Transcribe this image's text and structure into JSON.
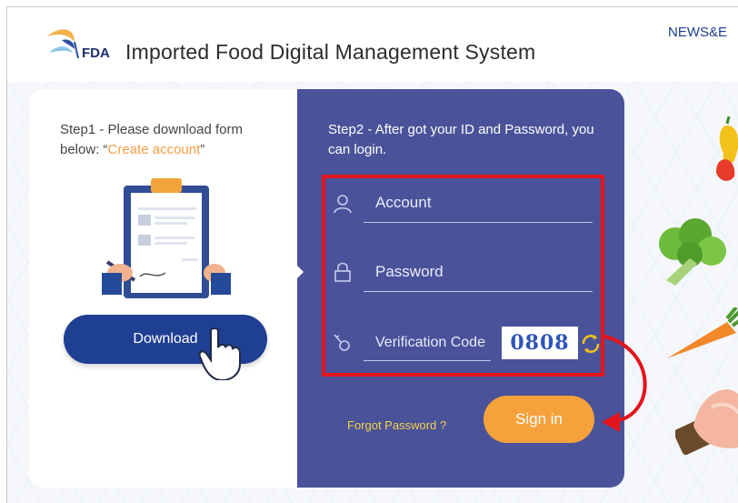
{
  "header": {
    "logo_text": "FDA",
    "title": "Imported Food Digital Management System",
    "news_link": "NEWS&E"
  },
  "left_panel": {
    "step_prefix": "Step1 - Please download form below: “",
    "create_link": "Create account",
    "step_suffix": "”",
    "download_label": "Download"
  },
  "right_panel": {
    "step_text": "Step2 - After got your ID and Password, you can login.",
    "account_placeholder": "Account",
    "password_placeholder": "Password",
    "verification_placeholder": "Verification Code",
    "captcha_value": "0808",
    "forgot_label": "Forgot Password ?",
    "signin_label": "Sign in"
  },
  "colors": {
    "panel_bg": "#4a529a",
    "download_btn": "#1f3f92",
    "signin_btn": "#f6a23c",
    "highlight": "#e3141c",
    "create_link": "#f59d43",
    "forgot_link": "#f2d34a"
  },
  "icons": [
    "fda-logo-icon",
    "user-icon",
    "lock-icon",
    "key-icon",
    "refresh-icon",
    "pointer-hand-icon",
    "clipboard-illustration"
  ]
}
